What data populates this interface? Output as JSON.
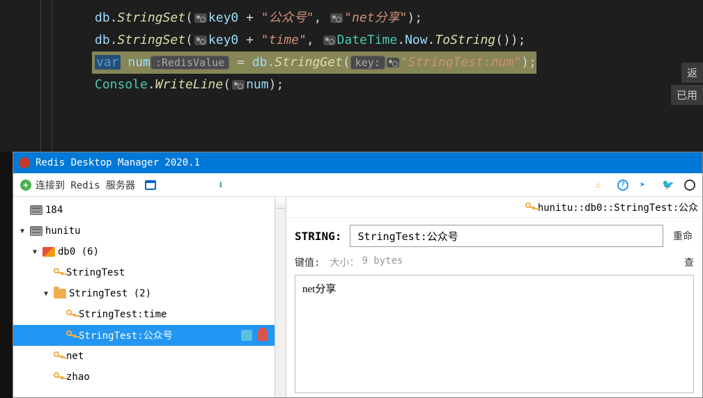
{
  "editor": {
    "lines": [
      {
        "parts": [
          {
            "t": "db",
            "c": "var"
          },
          {
            "t": ".",
            "c": "pun"
          },
          {
            "t": "StringSet",
            "c": "mth"
          },
          {
            "t": "(",
            "c": "pun"
          },
          {
            "ico": true
          },
          {
            "t": "key0",
            "c": "var"
          },
          {
            "t": " + ",
            "c": "pun"
          },
          {
            "t": "\"公众号\"",
            "c": "str"
          },
          {
            "t": ", ",
            "c": "pun"
          },
          {
            "ico": true
          },
          {
            "t": "\"net分享\"",
            "c": "str"
          },
          {
            "t": ");",
            "c": "pun"
          }
        ]
      },
      {
        "parts": [
          {
            "t": "db",
            "c": "var"
          },
          {
            "t": ".",
            "c": "pun"
          },
          {
            "t": "StringSet",
            "c": "mth"
          },
          {
            "t": "(",
            "c": "pun"
          },
          {
            "ico": true
          },
          {
            "t": "key0",
            "c": "var"
          },
          {
            "t": " + ",
            "c": "pun"
          },
          {
            "t": "\"time\"",
            "c": "str"
          },
          {
            "t": ", ",
            "c": "pun"
          },
          {
            "ico": true
          },
          {
            "t": "DateTime",
            "c": "cls"
          },
          {
            "t": ".",
            "c": "pun"
          },
          {
            "t": "Now",
            "c": "var"
          },
          {
            "t": ".",
            "c": "pun"
          },
          {
            "t": "ToString",
            "c": "mth"
          },
          {
            "t": "());",
            "c": "pun"
          }
        ],
        "sidebtn": "返"
      },
      {
        "hl": true,
        "parts": [
          {
            "t": "var",
            "c": "kw",
            "box": true
          },
          {
            "t": " ",
            "c": "pun"
          },
          {
            "t": "num",
            "c": "var"
          },
          {
            "hint": ":RedisValue"
          },
          {
            "t": " = ",
            "c": "pun"
          },
          {
            "t": "db",
            "c": "var"
          },
          {
            "t": ".",
            "c": "pun"
          },
          {
            "t": "StringGet",
            "c": "mth"
          },
          {
            "t": "(",
            "c": "pun"
          },
          {
            "hint": "key:"
          },
          {
            "ico": true
          },
          {
            "t": "\"StringTest:num\"",
            "c": "str"
          },
          {
            "t": ");",
            "c": "pun"
          }
        ],
        "sidebtn": "已用"
      },
      {
        "parts": [
          {
            "t": "Console",
            "c": "cls"
          },
          {
            "t": ".",
            "c": "pun"
          },
          {
            "t": "WriteLine",
            "c": "mth"
          },
          {
            "t": "(",
            "c": "pun"
          },
          {
            "ico": true
          },
          {
            "t": "num",
            "c": "var"
          },
          {
            "t": ");",
            "c": "pun"
          }
        ]
      }
    ]
  },
  "rdm": {
    "title": "Redis Desktop Manager 2020.1",
    "connect_label": "连接到 Redis 服务器",
    "path": "hunitu::db0::StringTest:公众",
    "type_label": "STRING:",
    "key_name": "StringTest:公众号",
    "rename_label": "重命",
    "value_label": "键值:",
    "size_label": "大小：",
    "size_value": "9 bytes",
    "view_label": "查",
    "value_text": "net分享",
    "tree": [
      {
        "indent": 0,
        "icon": "srv",
        "label": "184"
      },
      {
        "indent": 1,
        "arrow": "▼",
        "icon": "srv",
        "label": "hunitu"
      },
      {
        "indent": 2,
        "arrow": "▼",
        "icon": "db",
        "label": "db0  (6)"
      },
      {
        "indent": 3,
        "icon": "key",
        "label": "StringTest"
      },
      {
        "indent": 3,
        "arrow": "▼",
        "icon": "folder",
        "label": "StringTest (2)"
      },
      {
        "indent": 4,
        "icon": "key",
        "label": "StringTest:time"
      },
      {
        "indent": 4,
        "icon": "key",
        "label": "StringTest:公众号",
        "selected": true,
        "actions": true
      },
      {
        "indent": 3,
        "icon": "key",
        "label": "net"
      },
      {
        "indent": 3,
        "icon": "key",
        "label": "zhao"
      }
    ]
  }
}
